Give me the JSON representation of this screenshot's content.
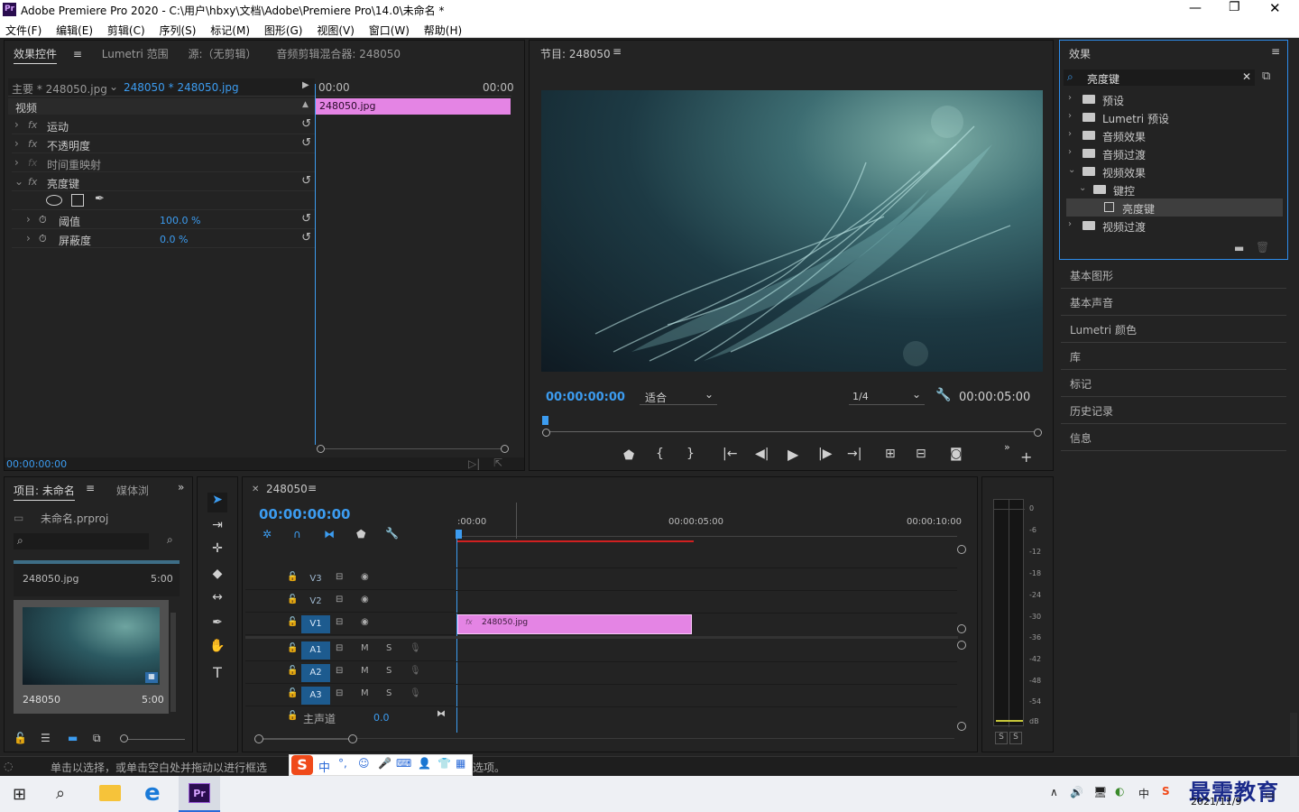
{
  "window": {
    "title": "Adobe Premiere Pro 2020 - C:\\用户\\hbxy\\文档\\Adobe\\Premiere Pro\\14.0\\未命名 *",
    "app_badge": "Pr"
  },
  "menu": [
    "文件(F)",
    "编辑(E)",
    "剪辑(C)",
    "序列(S)",
    "标记(M)",
    "图形(G)",
    "视图(V)",
    "窗口(W)",
    "帮助(H)"
  ],
  "effect_controls": {
    "tabs": [
      "效果控件",
      "Lumetri 范围",
      "源:（无剪辑）",
      "音频剪辑混合器: 248050"
    ],
    "master": "主要 * 248050.jpg",
    "clip": "248050 * 248050.jpg",
    "time_start": "00:00",
    "time_end": "00:00",
    "clip_bar": "248050.jpg",
    "section": "视频",
    "rows": [
      {
        "label": "运动"
      },
      {
        "label": "不透明度"
      },
      {
        "label": "时间重映射"
      },
      {
        "label": "亮度键"
      },
      {
        "label": "阈值",
        "value": "100.0 %"
      },
      {
        "label": "屏蔽度",
        "value": "0.0 %"
      }
    ],
    "timecode": "00:00:00:00"
  },
  "program": {
    "title": "节目: 248050",
    "timecode": "00:00:00:00",
    "fit": "适合",
    "resolution": "1/4",
    "duration": "00:00:05:00",
    "playhead_fraction": 0.0
  },
  "effects": {
    "title": "效果",
    "search": "亮度键",
    "tree": [
      {
        "label": "预设",
        "level": 0,
        "expanded": false
      },
      {
        "label": "Lumetri 预设",
        "level": 0,
        "expanded": false
      },
      {
        "label": "音频效果",
        "level": 0,
        "expanded": false
      },
      {
        "label": "音频过渡",
        "level": 0,
        "expanded": false
      },
      {
        "label": "视频效果",
        "level": 0,
        "expanded": true
      },
      {
        "label": "键控",
        "level": 1,
        "expanded": true
      },
      {
        "label": "亮度键",
        "level": 2,
        "selected": true
      },
      {
        "label": "视频过渡",
        "level": 0,
        "expanded": false
      }
    ]
  },
  "side_panels": [
    "基本图形",
    "基本声音",
    "Lumetri 颜色",
    "库",
    "标记",
    "历史记录",
    "信息"
  ],
  "project": {
    "tabs": [
      "项目: 未命名",
      "媒体浏"
    ],
    "file": "未命名.prproj",
    "items": [
      {
        "name": "248050.jpg",
        "dur": "5:00"
      },
      {
        "name": "248050",
        "dur": "5:00"
      }
    ]
  },
  "timeline": {
    "tab": "248050",
    "timecode": "00:00:00:00",
    "ruler": [
      ":00:00",
      "00:00:05:00",
      "00:00:10:00"
    ],
    "tracks": [
      {
        "name": "V3",
        "type": "video",
        "targeted": false
      },
      {
        "name": "V2",
        "type": "video",
        "targeted": false
      },
      {
        "name": "V1",
        "type": "video",
        "targeted": true
      },
      {
        "name": "A1",
        "type": "audio",
        "targeted": true
      },
      {
        "name": "A2",
        "type": "audio",
        "targeted": true
      },
      {
        "name": "A3",
        "type": "audio",
        "targeted": true
      }
    ],
    "master_label": "主声道",
    "master_value": "0.0",
    "clip": "248050.jpg",
    "audio_m": "M",
    "audio_s": "S"
  },
  "meter": {
    "labels": [
      "0",
      "-6",
      "-12",
      "-18",
      "-24",
      "-30",
      "-36",
      "-42",
      "-48",
      "-54",
      "dB"
    ],
    "solo": [
      "S",
      "S"
    ]
  },
  "status": {
    "text": "单击以选择，或单击空白处并拖动以进行框选",
    "text_tail": "选项。"
  },
  "ime": {
    "label": "中"
  },
  "taskbar": {
    "tray_ime": "中",
    "date": "2021/11/9",
    "watermark": "最需教育"
  },
  "colors": {
    "accent": "#3c9cf0",
    "clip": "#e484e4",
    "bar_red": "#d02020"
  }
}
